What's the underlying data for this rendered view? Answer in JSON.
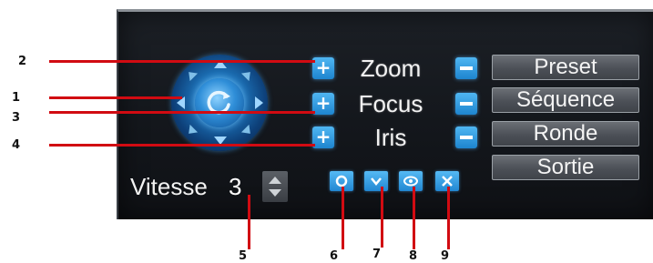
{
  "ptz": {
    "labels": {
      "zoom": "Zoom",
      "focus": "Focus",
      "iris": "Iris"
    },
    "plus_glyph": "+",
    "speed": {
      "label": "Vitesse",
      "value": "3"
    }
  },
  "menu": {
    "preset": "Preset",
    "sequence": "Séquence",
    "tour": "Ronde",
    "exit": "Sortie"
  },
  "callouts": {
    "c1": "1",
    "c2": "2",
    "c3": "3",
    "c4": "4",
    "c5": "5",
    "c6": "6",
    "c7": "7",
    "c8": "8",
    "c9": "9"
  },
  "colors": {
    "accent_blue": "#2187d2",
    "callout_red": "#d10b12",
    "panel_bg": "#13161b"
  },
  "icons": {
    "joystick_center": "refresh-icon",
    "small_buttons": [
      "circle-icon",
      "chevron-down-icon",
      "eye-icon",
      "close-icon"
    ]
  }
}
